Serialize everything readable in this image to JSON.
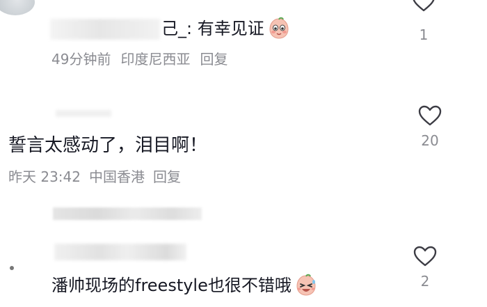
{
  "comments": [
    {
      "author_visible": "己_",
      "text": ": 有幸见证",
      "emoji": "blushing-face-emoji",
      "time": "49分钟前",
      "location": "印度尼西亚",
      "reply_label": "回复",
      "likes": "1"
    },
    {
      "text": "誓言太感动了，泪目啊！",
      "time": "昨天 23:42",
      "location": "中国香港",
      "reply_label": "回复",
      "likes": "20"
    },
    {
      "text": "潘帅现场的freestyle也很不错哦",
      "emoji": "laughing-crying-face-emoji",
      "likes": "2"
    }
  ],
  "colors": {
    "text": "#161823",
    "meta": "#8a8b91",
    "heart_outline": "#3c3c44",
    "emoji_fill": "#f6c3b4",
    "emoji_accent": "#e7746a"
  }
}
